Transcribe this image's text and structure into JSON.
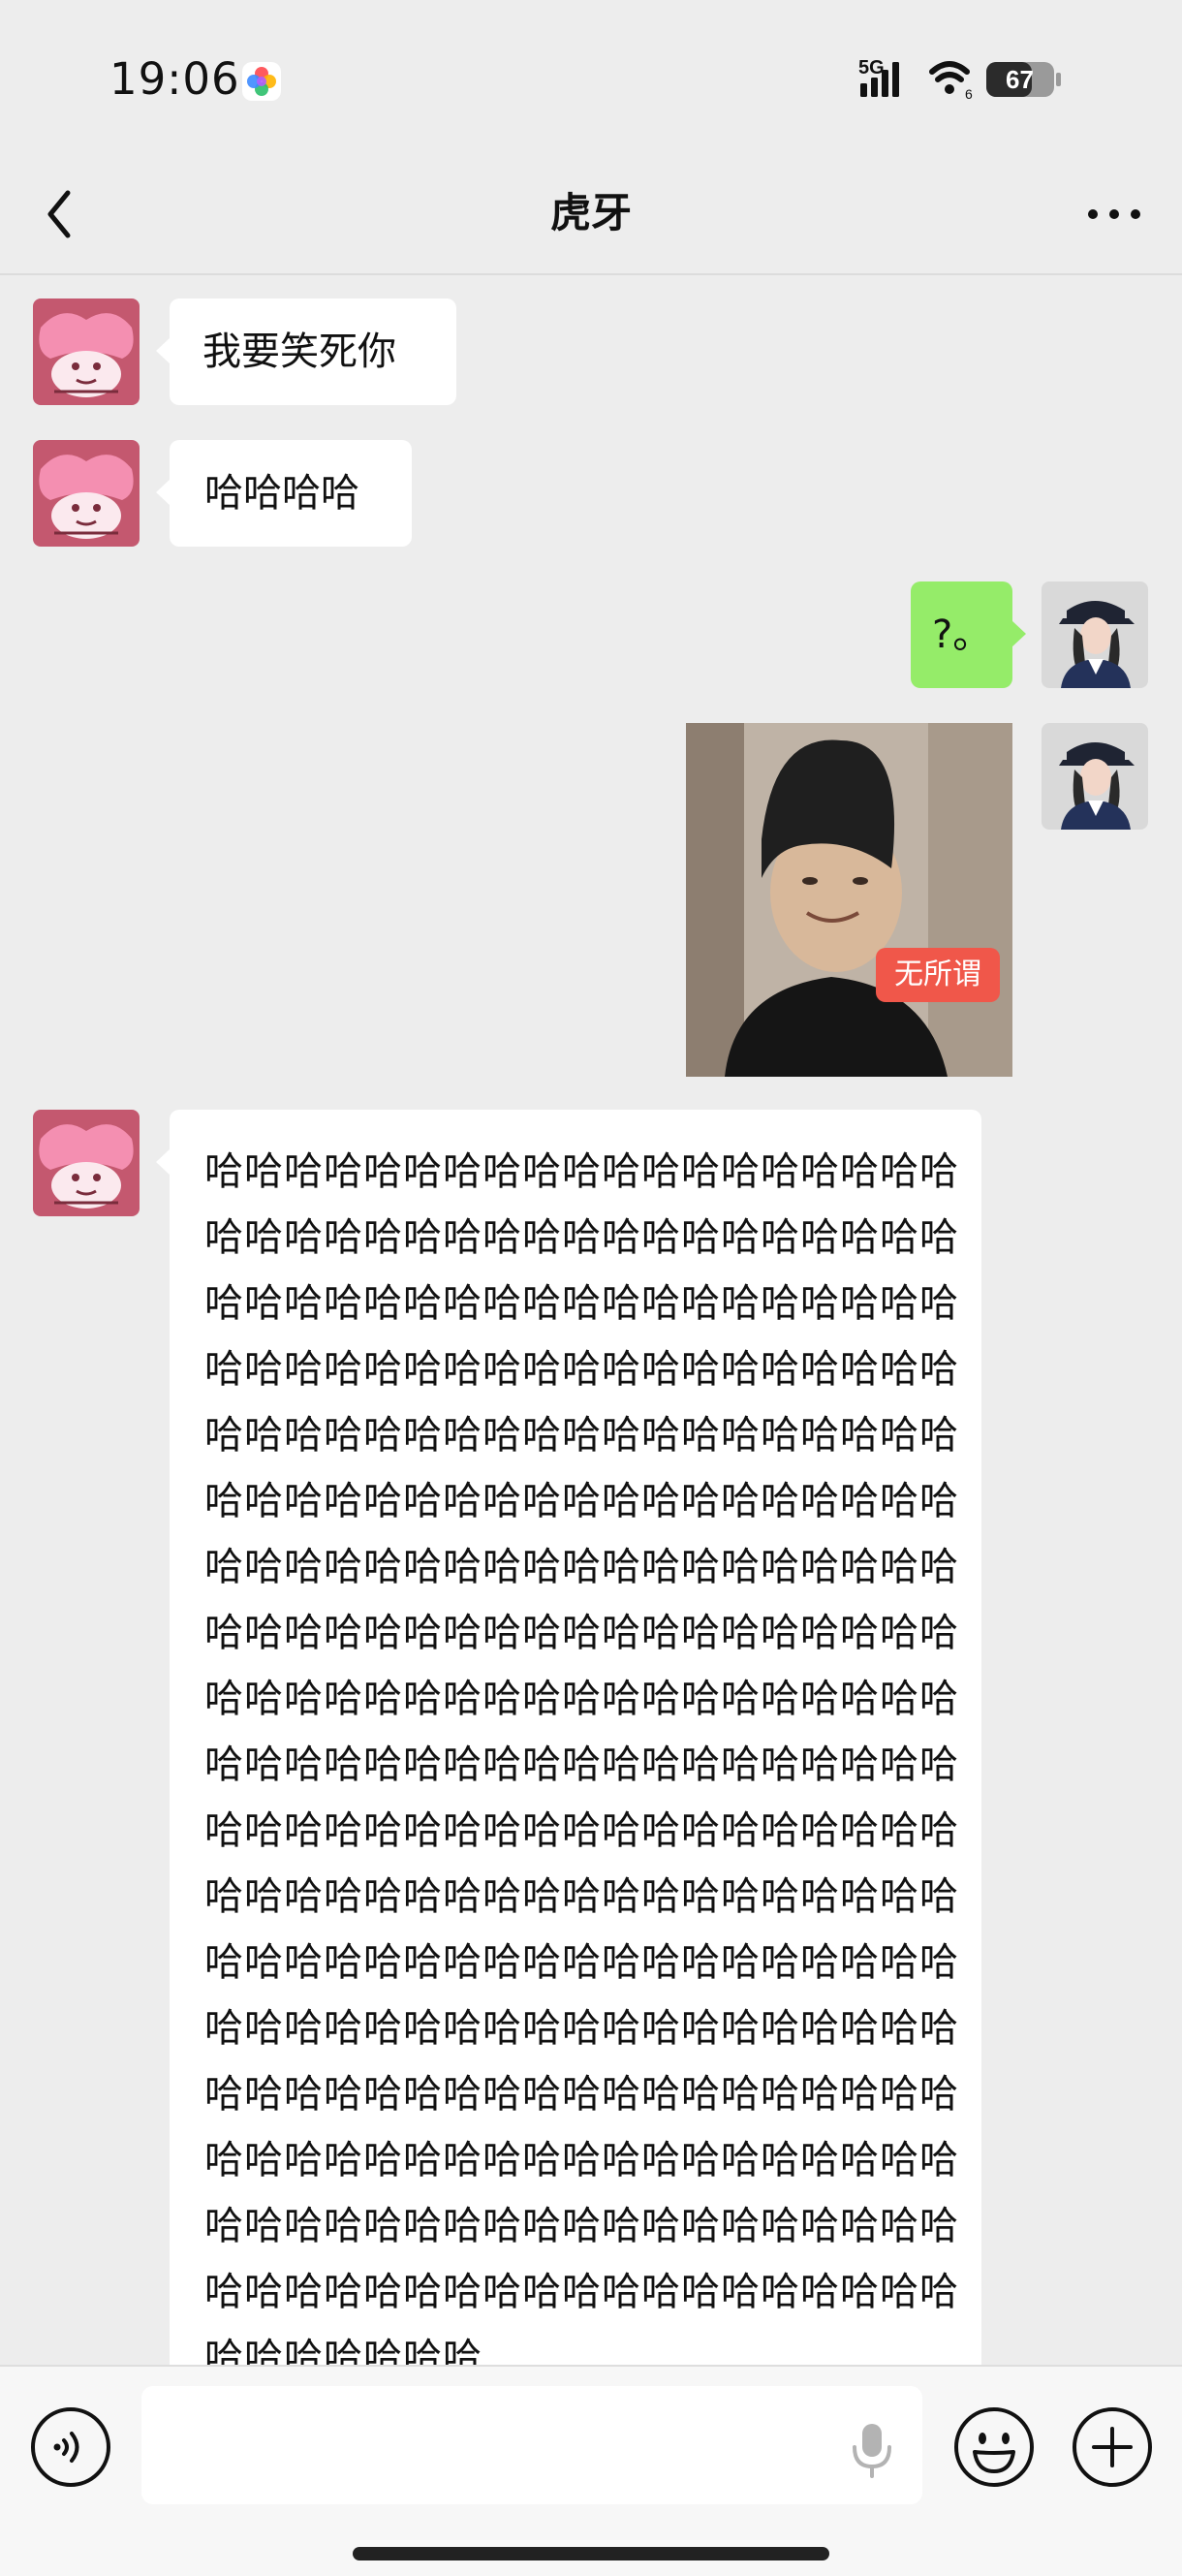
{
  "status_bar": {
    "time": "19:06",
    "network": "5G",
    "wifi_badge": "6",
    "battery": "67"
  },
  "header": {
    "title": "虎牙"
  },
  "messages": [
    {
      "side": "in",
      "type": "text",
      "text": "我要笑死你"
    },
    {
      "side": "in",
      "type": "text",
      "text": "哈哈哈哈"
    },
    {
      "side": "out",
      "type": "text",
      "text": "?。"
    },
    {
      "side": "out",
      "type": "image",
      "caption": "无所谓"
    },
    {
      "side": "in",
      "type": "text",
      "text": "哈哈哈哈哈哈哈哈哈哈哈哈哈哈哈哈哈哈哈哈哈哈哈哈哈哈哈哈哈哈哈哈哈哈哈哈哈哈哈哈哈哈哈哈哈哈哈哈哈哈哈哈哈哈哈哈哈哈哈哈哈哈哈哈哈哈哈哈哈哈哈哈哈哈哈哈哈哈哈哈哈哈哈哈哈哈哈哈哈哈哈哈哈哈哈哈哈哈哈哈哈哈哈哈哈哈哈哈哈哈哈哈哈哈哈哈哈哈哈哈哈哈哈哈哈哈哈哈哈哈哈哈哈哈哈哈哈哈哈哈哈哈哈哈哈哈哈哈哈哈哈哈哈哈哈哈哈哈哈哈哈哈哈哈哈哈哈哈哈哈哈哈哈哈哈哈哈哈哈哈哈哈哈哈哈哈哈哈哈哈哈哈哈哈哈哈哈哈哈哈哈哈哈哈哈哈哈哈哈哈哈哈哈哈哈哈哈哈哈哈哈哈哈哈哈哈哈哈哈哈哈哈哈哈哈哈哈哈哈哈哈哈哈哈哈哈哈哈哈哈哈哈哈哈哈哈哈哈哈哈哈哈哈哈哈哈哈哈哈哈哈哈哈哈哈哈哈哈哈哈哈哈哈哈哈哈哈哈哈哈哈哈哈哈哈哈哈哈哈哈哈哈哈哈哈哈哈哈哈哈哈哈哈哈哈哈哈哈哈哈哈哈哈哈哈哈哈哈哈哈哈哈哈哈哈哈哈哈哈哈哈哈哈哈哈哈哈哈哈"
    }
  ],
  "composer": {
    "placeholder": ""
  },
  "icons": {
    "back": "back-chevron-icon",
    "more": "more-dots-icon",
    "voice": "voice-toggle-icon",
    "mic": "microphone-icon",
    "emoji": "emoji-icon",
    "plus": "plus-icon"
  },
  "colors": {
    "background": "#ededed",
    "outgoing_bubble": "#95ec69",
    "incoming_bubble": "#ffffff",
    "caption_badge": "#f0574a"
  }
}
